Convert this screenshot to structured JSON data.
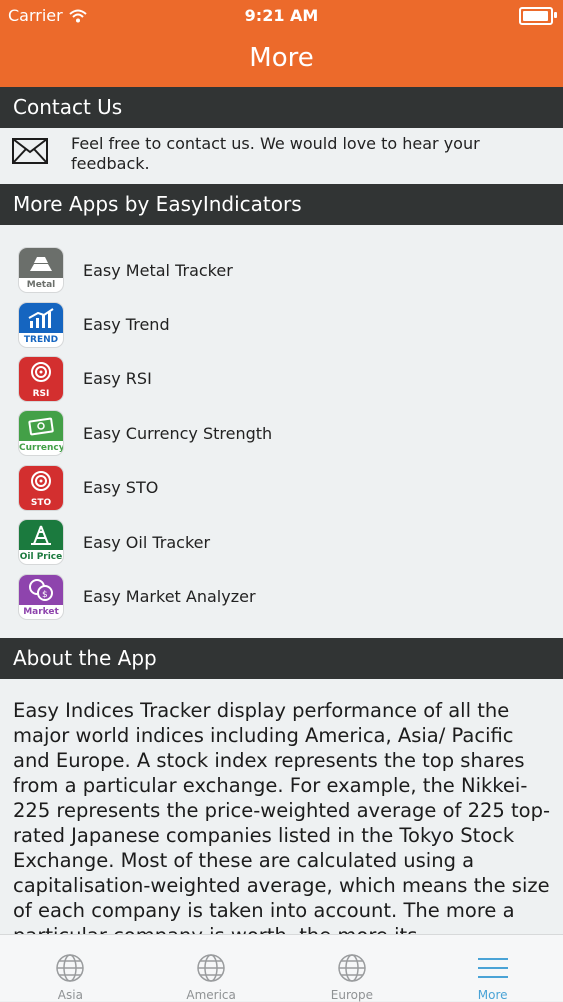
{
  "status": {
    "carrier": "Carrier",
    "time": "9:21 AM",
    "battery_level": 0.95
  },
  "nav": {
    "title": "More"
  },
  "contact": {
    "header": "Contact Us",
    "text": "Feel free to contact us. We would love to hear your feedback."
  },
  "more_apps": {
    "header": "More Apps by EasyIndicators",
    "items": [
      {
        "name": "Easy Metal Tracker",
        "icon_label": "Metal",
        "icon": "gold-bars-icon",
        "color": "#6b6f6b",
        "label_color": "#6b6f6b"
      },
      {
        "name": "Easy Trend",
        "icon_label": "TREND",
        "icon": "trend-chart-icon",
        "color": "#1565c0",
        "label_color": "#1565c0"
      },
      {
        "name": "Easy RSI",
        "icon_label": "RSI",
        "icon": "target-icon",
        "color": "#d32f2f",
        "label_color": "#ffffff"
      },
      {
        "name": "Easy Currency Strength",
        "icon_label": "Currency",
        "icon": "banknote-icon",
        "color": "#43a047",
        "label_color": "#43a047"
      },
      {
        "name": "Easy STO",
        "icon_label": "STO",
        "icon": "target-icon",
        "color": "#d32f2f",
        "label_color": "#ffffff"
      },
      {
        "name": "Easy Oil Tracker",
        "icon_label": "Oil Price",
        "icon": "oil-rig-icon",
        "color": "#1b7a3e",
        "label_color": "#1b7a3e"
      },
      {
        "name": "Easy Market Analyzer",
        "icon_label": "Market",
        "icon": "currency-exchange-icon",
        "color": "#8e44ad",
        "label_color": "#8e44ad"
      }
    ]
  },
  "about": {
    "header": "About the App",
    "text": "Easy Indices Tracker display performance of all the major world indices including America, Asia/ Pacific and Europe. A stock index represents the top shares from a particular exchange. For example, the Nikkei-225 represents the price-weighted average of 225 top-rated Japanese companies listed in the Tokyo Stock Exchange. Most of these are calculated using a capitalisation-weighted average, which means the size of each company is taken into account. The more a particular company is worth, the more its"
  },
  "tabs": [
    {
      "label": "Asia",
      "icon": "globe-icon",
      "active": false
    },
    {
      "label": "America",
      "icon": "globe-icon",
      "active": false
    },
    {
      "label": "Europe",
      "icon": "globe-icon",
      "active": false
    },
    {
      "label": "More",
      "icon": "menu-lines-icon",
      "active": true
    }
  ],
  "colors": {
    "accent": "#ec6a2b",
    "header_bg": "#313434",
    "tab_active": "#4aa3d6"
  }
}
